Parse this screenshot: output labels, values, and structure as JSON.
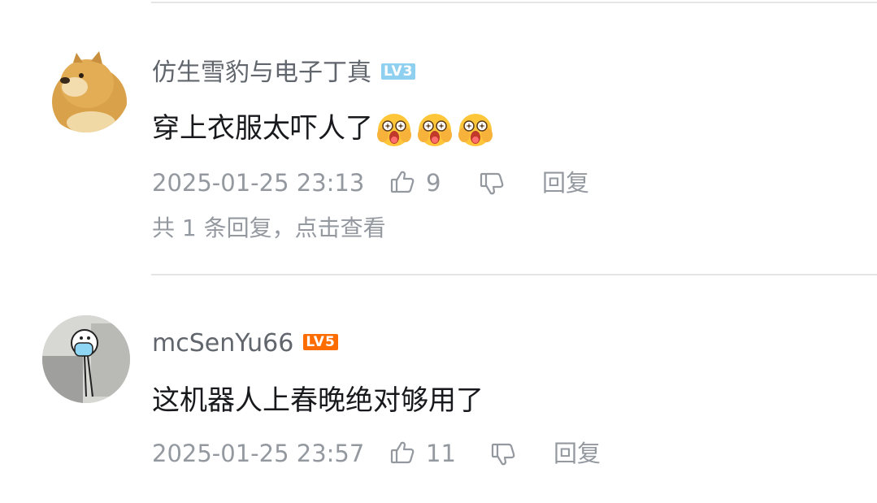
{
  "comments": [
    {
      "username": "仿生雪豹与电子丁真",
      "level": "LV3",
      "level_color": "#8fcff0",
      "text": "穿上衣服太吓人了",
      "emojis": [
        "shocked-face-icon",
        "shocked-face-icon",
        "shocked-face-icon"
      ],
      "time": "2025-01-25 23:13",
      "likes": "9",
      "reply_label": "回复",
      "reply_summary": "共 1 条回复，点击查看"
    },
    {
      "username": "mcSenYu66",
      "level": "LV5",
      "level_color": "#ff6c00",
      "text": "这机器人上春晚绝对够用了",
      "time": "2025-01-25 23:57",
      "likes": "11",
      "reply_label": "回复"
    }
  ]
}
